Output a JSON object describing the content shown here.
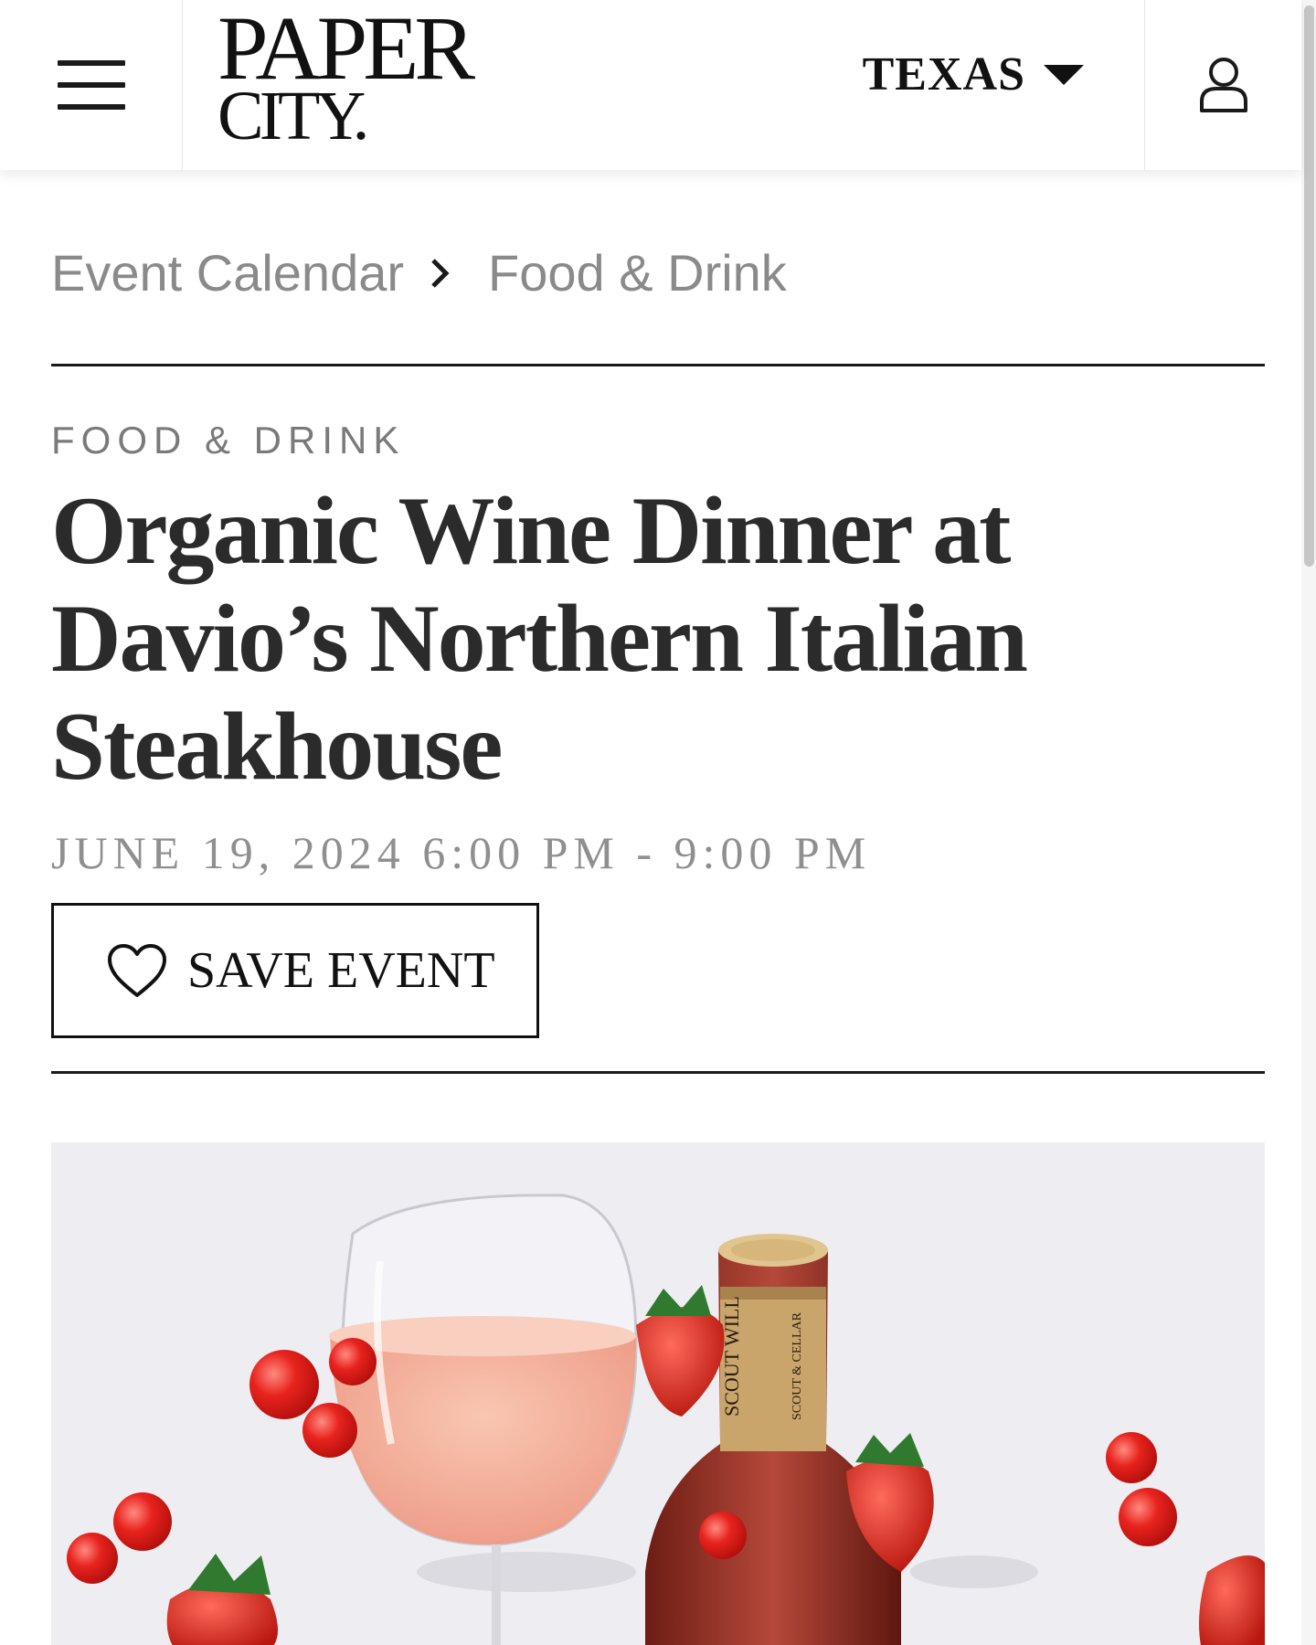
{
  "header": {
    "logo_line1": "PAPER",
    "logo_line2": "CITY.",
    "region": "TEXAS"
  },
  "breadcrumb": [
    {
      "label": "Event Calendar"
    },
    {
      "label": "Food & Drink"
    }
  ],
  "event": {
    "category": "FOOD & DRINK",
    "title": "Organic Wine Dinner at Davio’s Northern Italian Steakhouse",
    "datetime": "JUNE 19, 2024 6:00 PM - 9:00 PM",
    "save_label": "SAVE EVENT"
  },
  "hero": {
    "bottle_label": "SCOUT WILL",
    "bottle_sublabel": "SCOUT & CELLAR"
  }
}
